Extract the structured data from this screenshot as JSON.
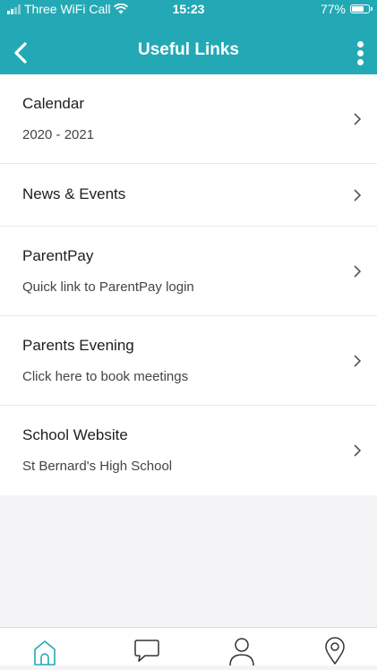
{
  "status_bar": {
    "carrier": "Three WiFi Call",
    "time": "15:23",
    "battery": "77%",
    "battery_level": 0.77
  },
  "header": {
    "title": "Useful Links"
  },
  "links": [
    {
      "title": "Calendar",
      "subtitle": "2020 - 2021"
    },
    {
      "title": "News & Events",
      "subtitle": ""
    },
    {
      "title": "ParentPay",
      "subtitle": "Quick link to ParentPay login"
    },
    {
      "title": "Parents Evening",
      "subtitle": "Click here to book meetings"
    },
    {
      "title": "School Website",
      "subtitle": "St Bernard's High School"
    }
  ],
  "tab_bar": {
    "tabs": [
      {
        "icon": "home-icon",
        "active": true
      },
      {
        "icon": "chat-icon",
        "active": false
      },
      {
        "icon": "profile-icon",
        "active": false
      },
      {
        "icon": "location-pin-icon",
        "active": false
      }
    ]
  },
  "colors": {
    "brand": "#23a9b5",
    "active_icon": "#23a9b5",
    "inactive_icon": "#333333"
  },
  "icons": {
    "back": "chevron-left-icon",
    "more": "kebab-menu-icon",
    "row": "chevron-right-icon"
  }
}
